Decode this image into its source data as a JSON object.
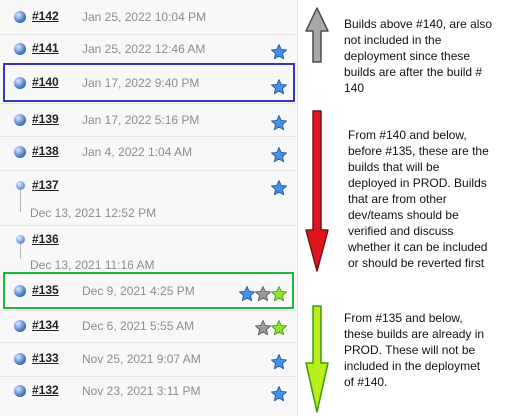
{
  "builds": [
    {
      "number": "#142",
      "date": "Jan 25, 2022 10:04 PM",
      "stars": []
    },
    {
      "number": "#141",
      "date": "Jan 25, 2022 12:46 AM",
      "stars": [
        "blue"
      ]
    },
    {
      "number": "#140",
      "date": "Jan 17, 2022 9:40 PM",
      "stars": [
        "blue"
      ]
    },
    {
      "number": "#139",
      "date": "Jan 17, 2022 5:16 PM",
      "stars": [
        "blue"
      ]
    },
    {
      "number": "#138",
      "date": "Jan 4, 2022 1:04 AM",
      "stars": [
        "blue"
      ]
    },
    {
      "number": "#137",
      "date": "Dec 13, 2021 12:52 PM",
      "stars": [
        "blue"
      ]
    },
    {
      "number": "#136",
      "date": "Dec 13, 2021 11:16 AM",
      "stars": []
    },
    {
      "number": "#135",
      "date": "Dec 9, 2021 4:25 PM",
      "stars": [
        "blue",
        "gray",
        "green"
      ]
    },
    {
      "number": "#134",
      "date": "Dec 6, 2021 5:55 AM",
      "stars": [
        "gray",
        "green"
      ]
    },
    {
      "number": "#133",
      "date": "Nov 25, 2021 9:07 AM",
      "stars": [
        "blue"
      ]
    },
    {
      "number": "#132",
      "date": "Nov 23, 2021 3:11 PM",
      "stars": [
        "blue"
      ]
    }
  ],
  "notes": {
    "top": [
      "Builds above #140, are also",
      "not included in the",
      "deployment since these",
      "builds are after the build #",
      "140"
    ],
    "middle": [
      "From #140 and below,",
      "before #135, these are the",
      "builds that will be",
      "deployed in PROD. Builds",
      "that are from other",
      "dev/teams should be",
      "verified and discuss",
      "whether it can be included",
      "or should be reverted first"
    ],
    "bottom": [
      "From #135 and below,",
      "these builds are already in",
      "PROD. These will not be",
      "included in the deploymet",
      "of #140."
    ]
  },
  "colors": {
    "star_blue": "#4a90e2",
    "star_gray": "#9a9a9a",
    "star_green": "#8fe23a",
    "highlight_blue": "#3636b9",
    "highlight_green": "#1eb739",
    "arrow_gray": "#a8a8a8",
    "arrow_red": "#e0161e",
    "arrow_green": "#b8ee1a"
  },
  "icons": {
    "status": "blue-ball-icon",
    "keep": "star-icon",
    "up_arrow": "gray-up-arrow",
    "down_arrow_red": "red-down-arrow",
    "down_arrow_green": "green-down-arrow"
  }
}
